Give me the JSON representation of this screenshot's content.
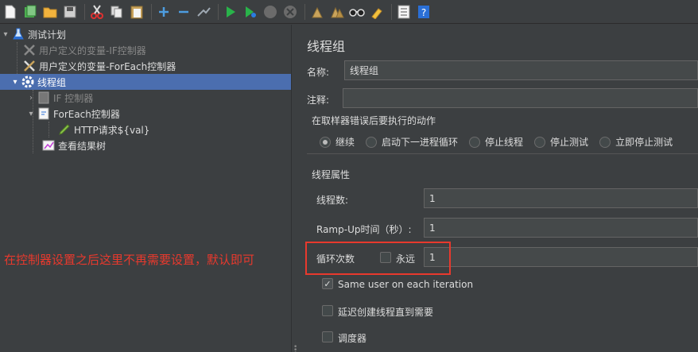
{
  "toolbar": {
    "buttons": [
      {
        "name": "new-icon",
        "glyph": "📄"
      },
      {
        "name": "templates-icon",
        "glyph": "📗"
      },
      {
        "name": "open-icon",
        "glyph": "📂"
      },
      {
        "name": "save-icon",
        "glyph": "💾"
      },
      {
        "name": "cut-icon",
        "glyph": "✂"
      },
      {
        "name": "copy-icon",
        "glyph": "⧉"
      },
      {
        "name": "paste-icon",
        "glyph": "📋"
      },
      {
        "name": "expand-icon",
        "glyph": "+"
      },
      {
        "name": "collapse-icon",
        "glyph": "−"
      },
      {
        "name": "toggle-icon",
        "glyph": "⤳"
      },
      {
        "name": "start-icon",
        "glyph": "▶"
      },
      {
        "name": "start-no-pauses-icon",
        "glyph": "▶"
      },
      {
        "name": "stop-icon",
        "glyph": "⬤"
      },
      {
        "name": "shutdown-icon",
        "glyph": "✖"
      },
      {
        "name": "clear-icon",
        "glyph": "🧹"
      },
      {
        "name": "clear-all-icon",
        "glyph": "🧹"
      },
      {
        "name": "search-icon",
        "glyph": "🔭"
      },
      {
        "name": "reset-search-icon",
        "glyph": "🧽"
      },
      {
        "name": "function-helper-icon",
        "glyph": "☰"
      },
      {
        "name": "help-icon",
        "glyph": "?"
      }
    ]
  },
  "tree": {
    "items": [
      {
        "label": "测试计划",
        "icon": "flask-icon"
      },
      {
        "label": "用户定义的变量-IF控制器",
        "icon": "wrench-icon",
        "disabled": true
      },
      {
        "label": "用户定义的变量-ForEach控制器",
        "icon": "wrench-icon"
      },
      {
        "label": "线程组",
        "icon": "gear-icon",
        "selected": true
      },
      {
        "label": "IF 控制器",
        "icon": "controller-icon",
        "disabled": true
      },
      {
        "label": "ForEach控制器",
        "icon": "controller-icon"
      },
      {
        "label": "HTTP请求${val}",
        "icon": "pen-icon"
      },
      {
        "label": "查看结果树",
        "icon": "chart-icon"
      }
    ]
  },
  "annotation": "在控制器设置之后这里不再需要设置，默认即可",
  "panel": {
    "title": "线程组",
    "name_label": "名称:",
    "name_value": "线程组",
    "comment_label": "注释:",
    "comment_value": "",
    "error_action_title": "在取样器错误后要执行的动作",
    "error_actions": [
      {
        "label": "继续",
        "selected": true
      },
      {
        "label": "启动下一进程循环",
        "selected": false
      },
      {
        "label": "停止线程",
        "selected": false
      },
      {
        "label": "停止测试",
        "selected": false
      },
      {
        "label": "立即停止测试",
        "selected": false
      }
    ],
    "thread_props_title": "线程属性",
    "threads_label": "线程数:",
    "threads_value": "1",
    "rampup_label": "Ramp-Up时间（秒）:",
    "rampup_value": "1",
    "loop_label": "循环次数",
    "forever_label": "永远",
    "forever_checked": false,
    "loop_value": "1",
    "same_user_label": "Same user on each iteration",
    "same_user_checked": true,
    "delay_label": "延迟创建线程直到需要",
    "delay_checked": false,
    "scheduler_label": "调度器",
    "scheduler_checked": false
  },
  "colors": {
    "accent_selection": "#4b6eaf",
    "annotation": "#e8392d"
  }
}
